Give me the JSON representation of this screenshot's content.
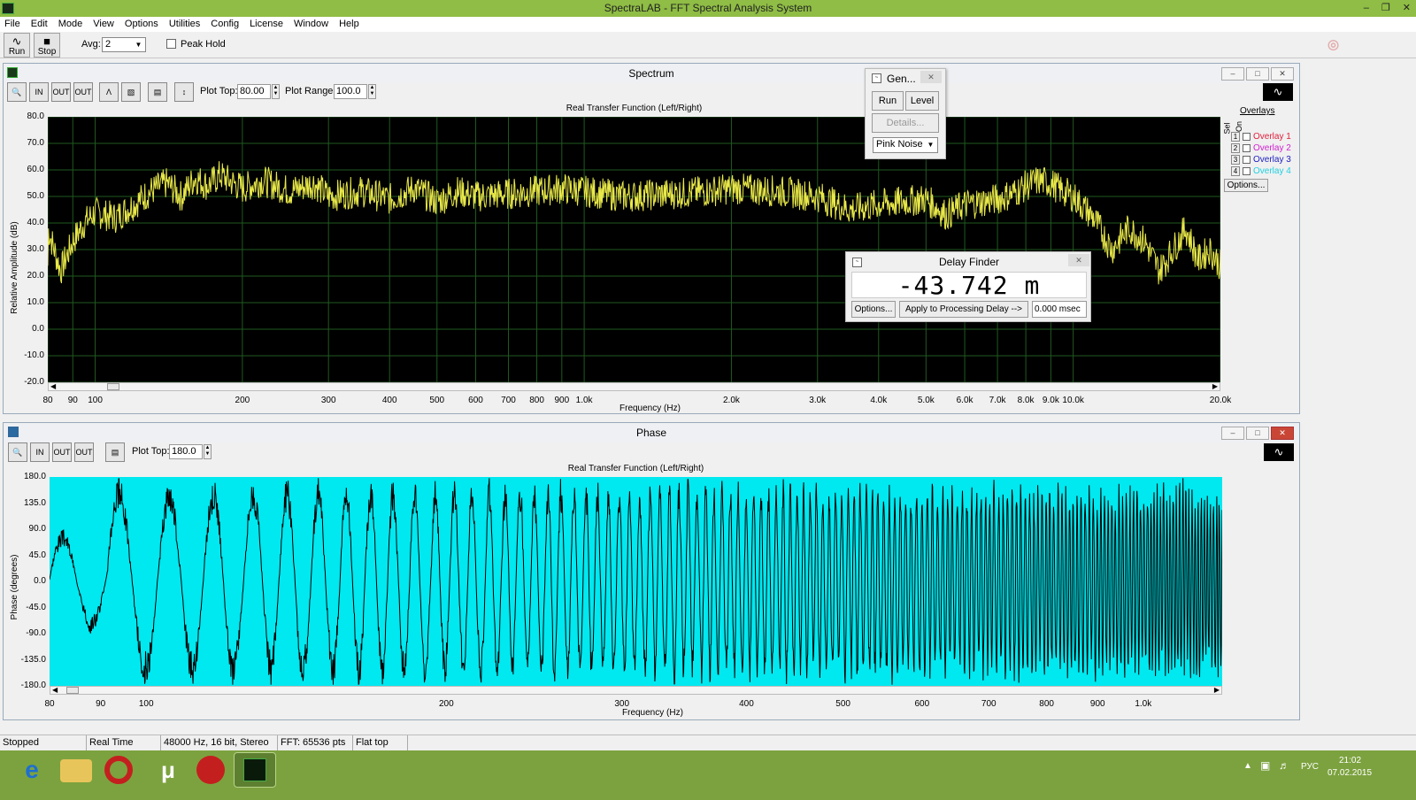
{
  "window": {
    "title": "SpectraLAB - FFT Spectral Analysis System"
  },
  "menu": [
    "File",
    "Edit",
    "Mode",
    "View",
    "Options",
    "Utilities",
    "Config",
    "License",
    "Window",
    "Help"
  ],
  "toolbar": {
    "run_label": "Run",
    "stop_label": "Stop",
    "avg_label": "Avg:",
    "avg_value": "2",
    "peak_hold_label": "Peak Hold",
    "peak_hold_checked": false
  },
  "spectrum": {
    "title": "Spectrum",
    "plot_top_label": "Plot Top:",
    "plot_top_value": "80.00",
    "plot_range_label": "Plot Range:",
    "plot_range_value": "100.0",
    "zoom_buttons": [
      "IN 2X",
      "OUT 2X",
      "OUT FULL"
    ],
    "chart_title": "Real Transfer Function (Left/Right)",
    "ylabel": "Relative Amplitude (dB)",
    "xlabel": "Frequency (Hz)",
    "yticks": [
      "80.0",
      "70.0",
      "60.0",
      "50.0",
      "40.0",
      "30.0",
      "20.0",
      "10.0",
      "0.0",
      "-10.0",
      "-20.0"
    ],
    "xticks": [
      "80",
      "90",
      "100",
      "200",
      "300",
      "400",
      "500",
      "600",
      "700",
      "800",
      "900",
      "1.0k",
      "2.0k",
      "3.0k",
      "4.0k",
      "5.0k",
      "6.0k",
      "7.0k",
      "8.0k",
      "9.0k",
      "10.0k",
      "20.0k"
    ],
    "overlays": {
      "title": "Overlays",
      "sel_label": "Sel",
      "on_label": "On",
      "items": [
        {
          "n": "1",
          "label": "Overlay 1",
          "color": "#e0203c"
        },
        {
          "n": "2",
          "label": "Overlay 2",
          "color": "#d020d0"
        },
        {
          "n": "3",
          "label": "Overlay 3",
          "color": "#2020c0"
        },
        {
          "n": "4",
          "label": "Overlay 4",
          "color": "#20d0e0"
        }
      ],
      "options_label": "Options..."
    }
  },
  "phase": {
    "title": "Phase",
    "plot_top_label": "Plot Top:",
    "plot_top_value": "180.0",
    "chart_title": "Real Transfer Function (Left/Right)",
    "ylabel": "Phase (degrees)",
    "xlabel": "Frequency (Hz)",
    "yticks": [
      "180.0",
      "135.0",
      "90.0",
      "45.0",
      "0.0",
      "-45.0",
      "-90.0",
      "-135.0",
      "-180.0"
    ],
    "xticks": [
      "80",
      "90",
      "100",
      "200",
      "300",
      "400",
      "500",
      "600",
      "700",
      "800",
      "900",
      "1.0k"
    ]
  },
  "generator": {
    "title": "Gen...",
    "run_label": "Run",
    "level_label": "Level",
    "details_label": "Details...",
    "signal": "Pink Noise"
  },
  "delay_finder": {
    "title": "Delay Finder",
    "value": "-43.742 m",
    "options_label": "Options...",
    "apply_label": "Apply to Processing Delay -->",
    "msec_value": "0.000 msec"
  },
  "status": [
    "Stopped",
    "Real Time",
    "48000 Hz, 16 bit, Stereo",
    "FFT: 65536 pts",
    "Flat top"
  ],
  "taskbar": {
    "lang": "РУС",
    "time": "21:02",
    "date": "07.02.2015"
  },
  "chart_data": [
    {
      "type": "line",
      "title": "Real Transfer Function (Left/Right)",
      "xlabel": "Frequency (Hz)",
      "ylabel": "Relative Amplitude (dB)",
      "xscale": "log",
      "xlim": [
        80,
        20000
      ],
      "ylim": [
        -20,
        80
      ],
      "grid": true,
      "color": "#e8e84a",
      "series": [
        {
          "x": [
            80,
            85,
            90,
            95,
            100,
            110,
            120,
            130,
            140,
            150,
            160,
            170,
            180,
            200,
            220,
            250,
            280,
            300,
            350,
            400,
            450,
            500,
            550,
            600,
            700,
            800,
            900,
            1000,
            1200,
            1500,
            1800,
            2000,
            2500,
            3000,
            3500,
            4000,
            4500,
            5000,
            5500,
            6000,
            6500,
            7000,
            7500,
            8000,
            8500,
            9000,
            9500,
            10000,
            11000,
            12000,
            13000,
            14000,
            15000,
            16000,
            17000,
            18000,
            19000,
            20000
          ],
          "y": [
            38,
            22,
            33,
            40,
            44,
            42,
            47,
            52,
            55,
            50,
            57,
            54,
            58,
            53,
            56,
            52,
            55,
            50,
            52,
            49,
            53,
            48,
            52,
            50,
            51,
            52,
            53,
            52,
            50,
            51,
            52,
            53,
            52,
            50,
            45,
            47,
            48,
            49,
            43,
            47,
            48,
            49,
            51,
            54,
            56,
            55,
            52,
            50,
            42,
            30,
            38,
            33,
            22,
            30,
            38,
            26,
            30,
            24
          ]
        }
      ]
    },
    {
      "type": "line",
      "title": "Real Transfer Function (Left/Right)",
      "xlabel": "Frequency (Hz)",
      "ylabel": "Phase (degrees)",
      "xscale": "log",
      "xlim": [
        80,
        1200
      ],
      "ylim": [
        -180,
        180
      ],
      "grid": false,
      "background": "#00e8f0",
      "color": "#000000",
      "series": [
        {
          "name": "",
          "note_wrapping_phase": true
        }
      ]
    }
  ]
}
